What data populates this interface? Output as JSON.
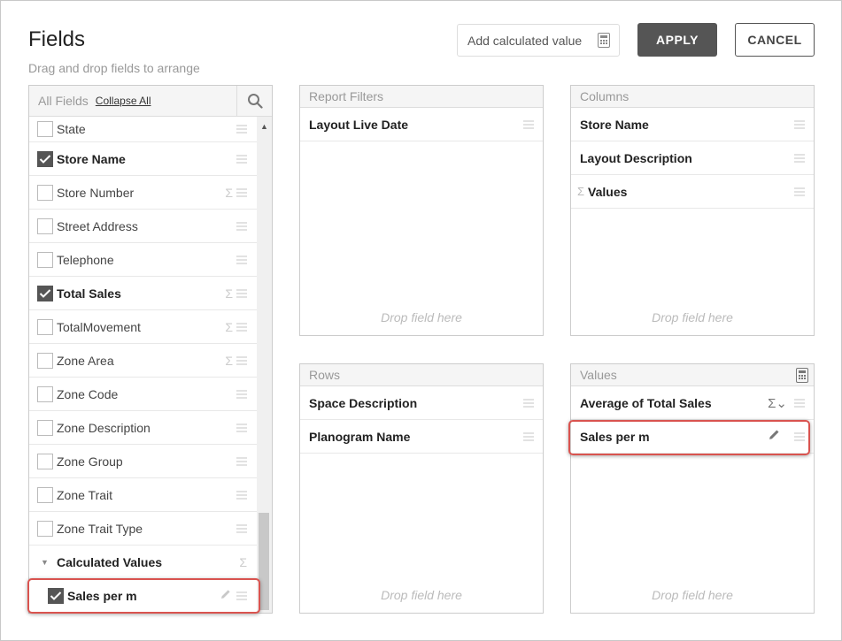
{
  "header": {
    "title": "Fields",
    "subtitle": "Drag and drop fields to arrange",
    "add_calculated_label": "Add calculated value",
    "apply_label": "APPLY",
    "cancel_label": "CANCEL"
  },
  "fields_panel": {
    "label": "All Fields",
    "collapse_label": "Collapse All",
    "items": [
      {
        "label": "State",
        "checked": false,
        "sigma": false
      },
      {
        "label": "Store Name",
        "checked": true,
        "sigma": false
      },
      {
        "label": "Store Number",
        "checked": false,
        "sigma": true
      },
      {
        "label": "Street Address",
        "checked": false,
        "sigma": false
      },
      {
        "label": "Telephone",
        "checked": false,
        "sigma": false
      },
      {
        "label": "Total Sales",
        "checked": true,
        "sigma": true
      },
      {
        "label": "TotalMovement",
        "checked": false,
        "sigma": true
      },
      {
        "label": "Zone Area",
        "checked": false,
        "sigma": true
      },
      {
        "label": "Zone Code",
        "checked": false,
        "sigma": false
      },
      {
        "label": "Zone Description",
        "checked": false,
        "sigma": false
      },
      {
        "label": "Zone Group",
        "checked": false,
        "sigma": false
      },
      {
        "label": "Zone Trait",
        "checked": false,
        "sigma": false
      },
      {
        "label": "Zone Trait Type",
        "checked": false,
        "sigma": false
      }
    ],
    "group_label": "Calculated Values",
    "calc_item_label": "Sales per m"
  },
  "report_filters": {
    "label": "Report Filters",
    "items": [
      "Layout Live Date"
    ],
    "drop_label": "Drop field here"
  },
  "columns": {
    "label": "Columns",
    "items": [
      "Store Name",
      "Layout Description"
    ],
    "values_item": "Values",
    "drop_label": "Drop field here"
  },
  "rows": {
    "label": "Rows",
    "items": [
      "Space Description",
      "Planogram Name"
    ],
    "drop_label": "Drop field here"
  },
  "values": {
    "label": "Values",
    "items": [
      "Average of Total Sales",
      "Sales per m"
    ],
    "drop_label": "Drop field here"
  },
  "glyphs": {
    "sigma": "Σ",
    "sigma_dropdown": "Σ⌄",
    "collapse_arrow": "▼",
    "scroll_up": "▲"
  },
  "colors": {
    "highlight": "#d9534f",
    "apply_bg": "#555555"
  }
}
